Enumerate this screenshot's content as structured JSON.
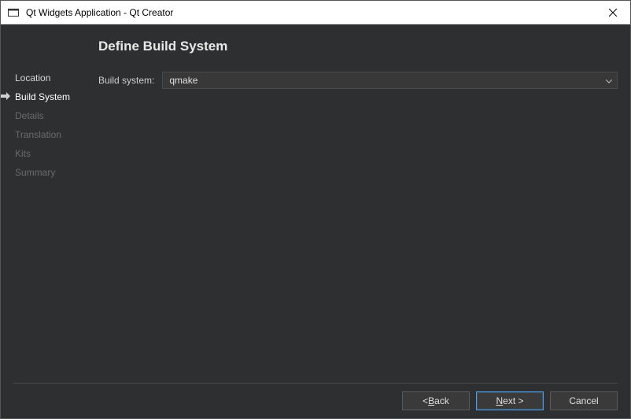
{
  "window": {
    "title": "Qt Widgets Application - Qt Creator"
  },
  "sidebar": {
    "steps": [
      {
        "label": "Location"
      },
      {
        "label": "Build System"
      },
      {
        "label": "Details"
      },
      {
        "label": "Translation"
      },
      {
        "label": "Kits"
      },
      {
        "label": "Summary"
      }
    ],
    "currentIndex": 1
  },
  "main": {
    "heading": "Define Build System",
    "buildSystem": {
      "label": "Build system:",
      "value": "qmake"
    }
  },
  "footer": {
    "back": {
      "prefix": "< ",
      "mnemonic": "B",
      "rest": "ack"
    },
    "next": {
      "mnemonic": "N",
      "rest": "ext >"
    },
    "cancel": "Cancel"
  }
}
